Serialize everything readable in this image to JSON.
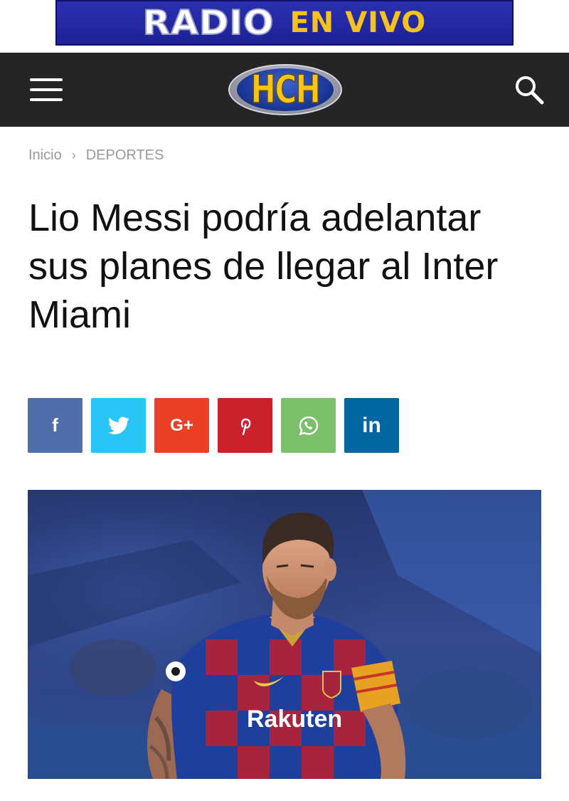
{
  "banner": {
    "radio_text": "RADIO",
    "envivo_text": "EN VIVO",
    "background_color": "#2a2fb0",
    "accent_color": "#f7c21b"
  },
  "header": {
    "menu_icon": "hamburger-menu-icon",
    "logo_text": "HCH",
    "search_icon": "search-icon",
    "background_color": "#252525"
  },
  "breadcrumb": {
    "home": "Inicio",
    "separator": "›",
    "category": "DEPORTES"
  },
  "article": {
    "title": "Lio Messi podría adelantar sus planes de llegar al Inter Miami",
    "image": {
      "subject": "soccer player in Barcelona jersey",
      "jersey_text": "Rakuten"
    }
  },
  "share_buttons": [
    {
      "network": "facebook",
      "icon": "facebook-icon",
      "glyph": "f",
      "color": "#516eab"
    },
    {
      "network": "twitter",
      "icon": "twitter-icon",
      "glyph": "",
      "color": "#29c5f6"
    },
    {
      "network": "google-plus",
      "icon": "google-plus-icon",
      "glyph": "G+",
      "color": "#eb4026"
    },
    {
      "network": "pinterest",
      "icon": "pinterest-icon",
      "glyph": "P",
      "color": "#ca212a"
    },
    {
      "network": "whatsapp",
      "icon": "whatsapp-icon",
      "glyph": "",
      "color": "#7bbf6a"
    },
    {
      "network": "linkedin",
      "icon": "linkedin-icon",
      "glyph": "in",
      "color": "#0266a0"
    }
  ]
}
